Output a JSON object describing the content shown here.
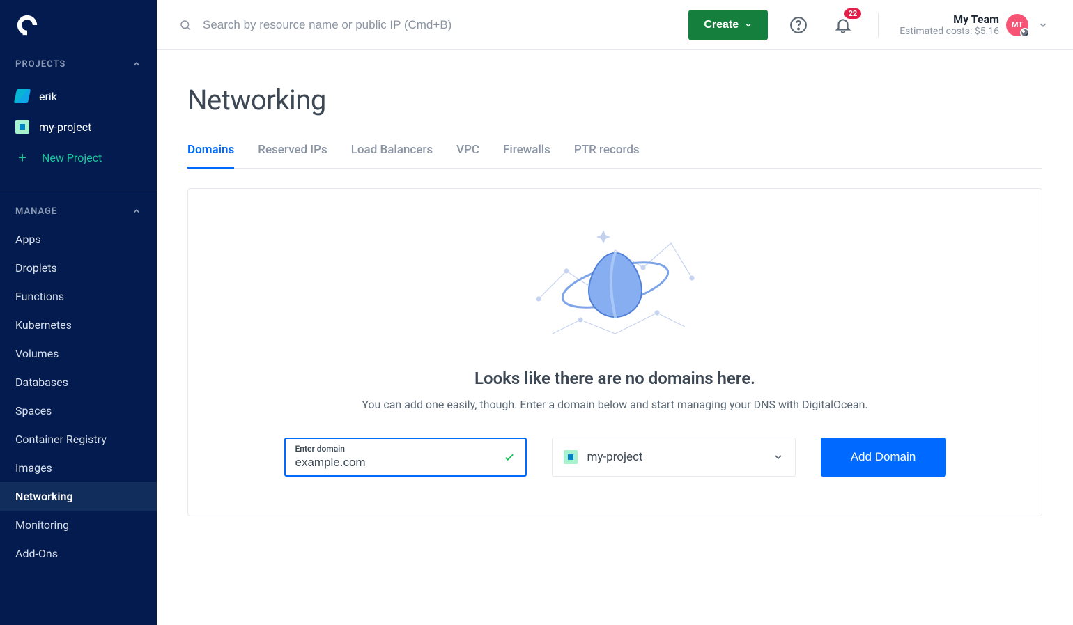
{
  "sidebar": {
    "sections": {
      "projects_label": "PROJECTS",
      "manage_label": "MANAGE"
    },
    "projects": [
      {
        "label": "erik"
      },
      {
        "label": "my-project"
      }
    ],
    "new_project_label": "New Project",
    "manage": [
      {
        "label": "Apps"
      },
      {
        "label": "Droplets"
      },
      {
        "label": "Functions"
      },
      {
        "label": "Kubernetes"
      },
      {
        "label": "Volumes"
      },
      {
        "label": "Databases"
      },
      {
        "label": "Spaces"
      },
      {
        "label": "Container Registry"
      },
      {
        "label": "Images"
      },
      {
        "label": "Networking",
        "active": true
      },
      {
        "label": "Monitoring"
      },
      {
        "label": "Add-Ons"
      }
    ]
  },
  "topbar": {
    "search_placeholder": "Search by resource name or public IP (Cmd+B)",
    "create_label": "Create",
    "notifications_count": "22",
    "team_name": "My Team",
    "team_cost_label": "Estimated costs: $5.16",
    "avatar_initials": "MT"
  },
  "page": {
    "title": "Networking",
    "tabs": [
      {
        "label": "Domains",
        "active": true
      },
      {
        "label": "Reserved IPs"
      },
      {
        "label": "Load Balancers"
      },
      {
        "label": "VPC"
      },
      {
        "label": "Firewalls"
      },
      {
        "label": "PTR records"
      }
    ],
    "empty_title": "Looks like there are no domains here.",
    "empty_sub": "You can add one easily, though. Enter a domain below and start managing your DNS with DigitalOcean.",
    "domain_field_label": "Enter domain",
    "domain_value": "example.com",
    "project_selected": "my-project",
    "add_button_label": "Add Domain"
  }
}
